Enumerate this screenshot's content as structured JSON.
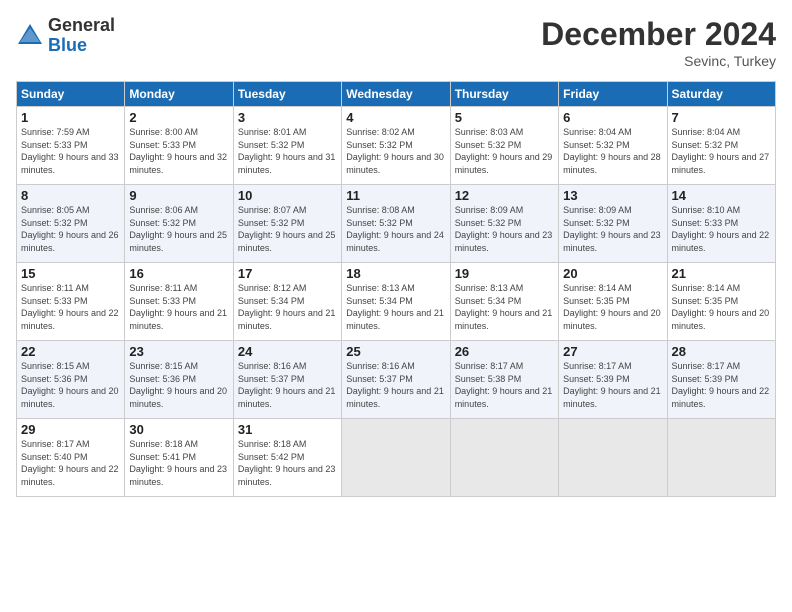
{
  "logo": {
    "general": "General",
    "blue": "Blue"
  },
  "title": "December 2024",
  "location": "Sevinc, Turkey",
  "days_header": [
    "Sunday",
    "Monday",
    "Tuesday",
    "Wednesday",
    "Thursday",
    "Friday",
    "Saturday"
  ],
  "weeks": [
    [
      {
        "num": "1",
        "sunrise": "Sunrise: 7:59 AM",
        "sunset": "Sunset: 5:33 PM",
        "daylight": "Daylight: 9 hours and 33 minutes."
      },
      {
        "num": "2",
        "sunrise": "Sunrise: 8:00 AM",
        "sunset": "Sunset: 5:33 PM",
        "daylight": "Daylight: 9 hours and 32 minutes."
      },
      {
        "num": "3",
        "sunrise": "Sunrise: 8:01 AM",
        "sunset": "Sunset: 5:32 PM",
        "daylight": "Daylight: 9 hours and 31 minutes."
      },
      {
        "num": "4",
        "sunrise": "Sunrise: 8:02 AM",
        "sunset": "Sunset: 5:32 PM",
        "daylight": "Daylight: 9 hours and 30 minutes."
      },
      {
        "num": "5",
        "sunrise": "Sunrise: 8:03 AM",
        "sunset": "Sunset: 5:32 PM",
        "daylight": "Daylight: 9 hours and 29 minutes."
      },
      {
        "num": "6",
        "sunrise": "Sunrise: 8:04 AM",
        "sunset": "Sunset: 5:32 PM",
        "daylight": "Daylight: 9 hours and 28 minutes."
      },
      {
        "num": "7",
        "sunrise": "Sunrise: 8:04 AM",
        "sunset": "Sunset: 5:32 PM",
        "daylight": "Daylight: 9 hours and 27 minutes."
      }
    ],
    [
      {
        "num": "8",
        "sunrise": "Sunrise: 8:05 AM",
        "sunset": "Sunset: 5:32 PM",
        "daylight": "Daylight: 9 hours and 26 minutes."
      },
      {
        "num": "9",
        "sunrise": "Sunrise: 8:06 AM",
        "sunset": "Sunset: 5:32 PM",
        "daylight": "Daylight: 9 hours and 25 minutes."
      },
      {
        "num": "10",
        "sunrise": "Sunrise: 8:07 AM",
        "sunset": "Sunset: 5:32 PM",
        "daylight": "Daylight: 9 hours and 25 minutes."
      },
      {
        "num": "11",
        "sunrise": "Sunrise: 8:08 AM",
        "sunset": "Sunset: 5:32 PM",
        "daylight": "Daylight: 9 hours and 24 minutes."
      },
      {
        "num": "12",
        "sunrise": "Sunrise: 8:09 AM",
        "sunset": "Sunset: 5:32 PM",
        "daylight": "Daylight: 9 hours and 23 minutes."
      },
      {
        "num": "13",
        "sunrise": "Sunrise: 8:09 AM",
        "sunset": "Sunset: 5:32 PM",
        "daylight": "Daylight: 9 hours and 23 minutes."
      },
      {
        "num": "14",
        "sunrise": "Sunrise: 8:10 AM",
        "sunset": "Sunset: 5:33 PM",
        "daylight": "Daylight: 9 hours and 22 minutes."
      }
    ],
    [
      {
        "num": "15",
        "sunrise": "Sunrise: 8:11 AM",
        "sunset": "Sunset: 5:33 PM",
        "daylight": "Daylight: 9 hours and 22 minutes."
      },
      {
        "num": "16",
        "sunrise": "Sunrise: 8:11 AM",
        "sunset": "Sunset: 5:33 PM",
        "daylight": "Daylight: 9 hours and 21 minutes."
      },
      {
        "num": "17",
        "sunrise": "Sunrise: 8:12 AM",
        "sunset": "Sunset: 5:34 PM",
        "daylight": "Daylight: 9 hours and 21 minutes."
      },
      {
        "num": "18",
        "sunrise": "Sunrise: 8:13 AM",
        "sunset": "Sunset: 5:34 PM",
        "daylight": "Daylight: 9 hours and 21 minutes."
      },
      {
        "num": "19",
        "sunrise": "Sunrise: 8:13 AM",
        "sunset": "Sunset: 5:34 PM",
        "daylight": "Daylight: 9 hours and 21 minutes."
      },
      {
        "num": "20",
        "sunrise": "Sunrise: 8:14 AM",
        "sunset": "Sunset: 5:35 PM",
        "daylight": "Daylight: 9 hours and 20 minutes."
      },
      {
        "num": "21",
        "sunrise": "Sunrise: 8:14 AM",
        "sunset": "Sunset: 5:35 PM",
        "daylight": "Daylight: 9 hours and 20 minutes."
      }
    ],
    [
      {
        "num": "22",
        "sunrise": "Sunrise: 8:15 AM",
        "sunset": "Sunset: 5:36 PM",
        "daylight": "Daylight: 9 hours and 20 minutes."
      },
      {
        "num": "23",
        "sunrise": "Sunrise: 8:15 AM",
        "sunset": "Sunset: 5:36 PM",
        "daylight": "Daylight: 9 hours and 20 minutes."
      },
      {
        "num": "24",
        "sunrise": "Sunrise: 8:16 AM",
        "sunset": "Sunset: 5:37 PM",
        "daylight": "Daylight: 9 hours and 21 minutes."
      },
      {
        "num": "25",
        "sunrise": "Sunrise: 8:16 AM",
        "sunset": "Sunset: 5:37 PM",
        "daylight": "Daylight: 9 hours and 21 minutes."
      },
      {
        "num": "26",
        "sunrise": "Sunrise: 8:17 AM",
        "sunset": "Sunset: 5:38 PM",
        "daylight": "Daylight: 9 hours and 21 minutes."
      },
      {
        "num": "27",
        "sunrise": "Sunrise: 8:17 AM",
        "sunset": "Sunset: 5:39 PM",
        "daylight": "Daylight: 9 hours and 21 minutes."
      },
      {
        "num": "28",
        "sunrise": "Sunrise: 8:17 AM",
        "sunset": "Sunset: 5:39 PM",
        "daylight": "Daylight: 9 hours and 22 minutes."
      }
    ],
    [
      {
        "num": "29",
        "sunrise": "Sunrise: 8:17 AM",
        "sunset": "Sunset: 5:40 PM",
        "daylight": "Daylight: 9 hours and 22 minutes."
      },
      {
        "num": "30",
        "sunrise": "Sunrise: 8:18 AM",
        "sunset": "Sunset: 5:41 PM",
        "daylight": "Daylight: 9 hours and 23 minutes."
      },
      {
        "num": "31",
        "sunrise": "Sunrise: 8:18 AM",
        "sunset": "Sunset: 5:42 PM",
        "daylight": "Daylight: 9 hours and 23 minutes."
      },
      null,
      null,
      null,
      null
    ]
  ]
}
